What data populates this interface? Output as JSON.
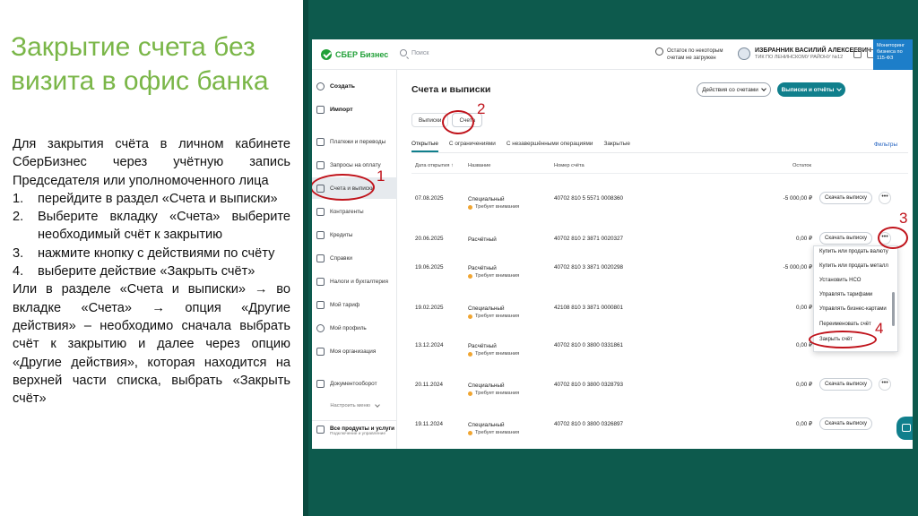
{
  "slide": {
    "title": "Закрытие счета без визита в офис банка",
    "intro": "Для закрытия счёта в личном кабинете СберБизнес через учётную запись Председателя или уполномоченного лица",
    "steps": [
      {
        "num": "1.",
        "text": "перейдите в раздел «Счета и выписки»"
      },
      {
        "num": "2.",
        "text": "Выберите вкладку «Счета» выберите необходимый счёт к закрытию"
      },
      {
        "num": "3.",
        "text": "нажмите кнопку с действиями по счёту"
      },
      {
        "num": "4.",
        "text": "выберите действие «Закрыть счёт»"
      }
    ],
    "outro": "Или в разделе «Счета и выписки» → во вкладке «Счета» → опция «Другие действия» – необходимо сначала выбрать счёт к закрытию и далее через опцию «Другие действия», которая находится на верхней части списка, выбрать «Закрыть счёт»"
  },
  "colors": {
    "title_green": "#7ab648",
    "band_teal": "#0d5a4d",
    "accent_teal": "#107f8c",
    "annotation_red": "#c0131b",
    "status_orange": "#f0a531"
  },
  "app": {
    "logo": "СБЕР Бизнес",
    "search_placeholder": "Поиск",
    "balance_note": "Остаток по некоторым счетам не загружен",
    "user_name": "ИЗБРАННИК ВАСИЛИЙ АЛЕКСЕЕВИЧ",
    "user_sub": "ТИК ПО ЛЕНИНСКОМУ РАЙОНУ №12",
    "promo": "Мониторинг бизнеса по 115-ФЗ",
    "top_icons": [
      "user-icon",
      "settings-icon",
      "bell-icon"
    ]
  },
  "sidebar": {
    "create": "Создать",
    "import": "Импорт",
    "items": [
      "Платежи и переводы",
      "Запросы на оплату",
      "Счета и выписки",
      "Контрагенты",
      "Кредиты",
      "Справки",
      "Налоги и бухгалтерия",
      "Мой тариф",
      "Мой профиль",
      "Моя организация",
      "Документооборот"
    ],
    "more": "Настроить меню",
    "bottom_title": "Все продукты и услуги",
    "bottom_sub": "Подключение и управление"
  },
  "main": {
    "title": "Счета и выписки",
    "actions_button": "Действия со счетами",
    "statements_button": "Выписки и отчёты",
    "tabs": [
      "Выписки",
      "Счета"
    ],
    "filters": [
      "Открытые",
      "С ограничениями",
      "С незавершёнными операциями",
      "Закрытые"
    ],
    "filters_link": "Фильтры",
    "columns": {
      "date": "Дата открытия ↑",
      "name": "Название",
      "account": "Номер счёта",
      "balance": "Остаток"
    },
    "row_button": "Скачать выписку",
    "more_glyph": "•••",
    "rows": [
      {
        "date": "07.08.2025",
        "name": "Специальный",
        "status": "Требует внимания",
        "account": "40702 810 5 5571 0008360",
        "balance": "-5 000,00 ₽"
      },
      {
        "date": "20.06.2025",
        "name": "Расчётный",
        "status": "",
        "account": "40702 810 2 3871 0020327",
        "balance": "0,00 ₽"
      },
      {
        "date": "19.06.2025",
        "name": "Расчётный",
        "status": "Требует внимания",
        "account": "40702 810 3 3871 0020298",
        "balance": "-5 000,00 ₽"
      },
      {
        "date": "19.02.2025",
        "name": "Специальный",
        "status": "Требует внимания",
        "account": "42108 810 3 3871 0000801",
        "balance": "0,00 ₽"
      },
      {
        "date": "13.12.2024",
        "name": "Расчётный",
        "status": "Требует внимания",
        "account": "40702 810 0 3800 0331861",
        "balance": "0,00 ₽"
      },
      {
        "date": "20.11.2024",
        "name": "Специальный",
        "status": "Требует внимания",
        "account": "40702 810 0 3800 0328793",
        "balance": "0,00 ₽"
      },
      {
        "date": "19.11.2024",
        "name": "Специальный",
        "status": "Требует внимания",
        "account": "40702 810 0 3800 0326897",
        "balance": "0,00 ₽"
      }
    ],
    "dropdown": [
      "Купить или продать валюту",
      "Купить или продать металл",
      "Установить НСО",
      "Управлять тарифами",
      "Управлять бизнес-картами",
      "Переименовать счёт",
      "Закрыть счёт"
    ]
  },
  "annotations": [
    "1",
    "2",
    "3",
    "4"
  ]
}
